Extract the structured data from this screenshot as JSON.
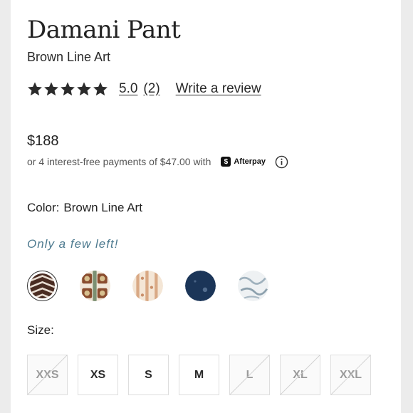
{
  "product": {
    "title": "Damani Pant",
    "color_name": "Brown Line Art"
  },
  "rating": {
    "stars": 5,
    "value": "5.0",
    "count": "(2)",
    "write_review": "Write a review"
  },
  "pricing": {
    "price": "$188",
    "installment_text": "or 4 interest-free payments of $47.00 with",
    "afterpay_label": "Afterpay",
    "afterpay_icon": "afterpay-logo-icon",
    "info_icon": "info-icon"
  },
  "color": {
    "label": "Color:",
    "value": "Brown Line Art"
  },
  "stock_message": "Only a few left!",
  "swatches": [
    {
      "name": "brown-line-art",
      "selected": true
    },
    {
      "name": "brown-floral",
      "selected": false
    },
    {
      "name": "cream-stripe",
      "selected": false
    },
    {
      "name": "navy-print",
      "selected": false
    },
    {
      "name": "white-marble",
      "selected": false
    }
  ],
  "size": {
    "label": "Size:",
    "options": [
      {
        "label": "XXS",
        "available": false
      },
      {
        "label": "XS",
        "available": true
      },
      {
        "label": "S",
        "available": true
      },
      {
        "label": "M",
        "available": true
      },
      {
        "label": "L",
        "available": false
      },
      {
        "label": "XL",
        "available": false
      },
      {
        "label": "XXL",
        "available": false
      }
    ]
  },
  "colors": {
    "text": "#222222",
    "stock_accent": "#4d7a8f",
    "border": "#dedede"
  }
}
